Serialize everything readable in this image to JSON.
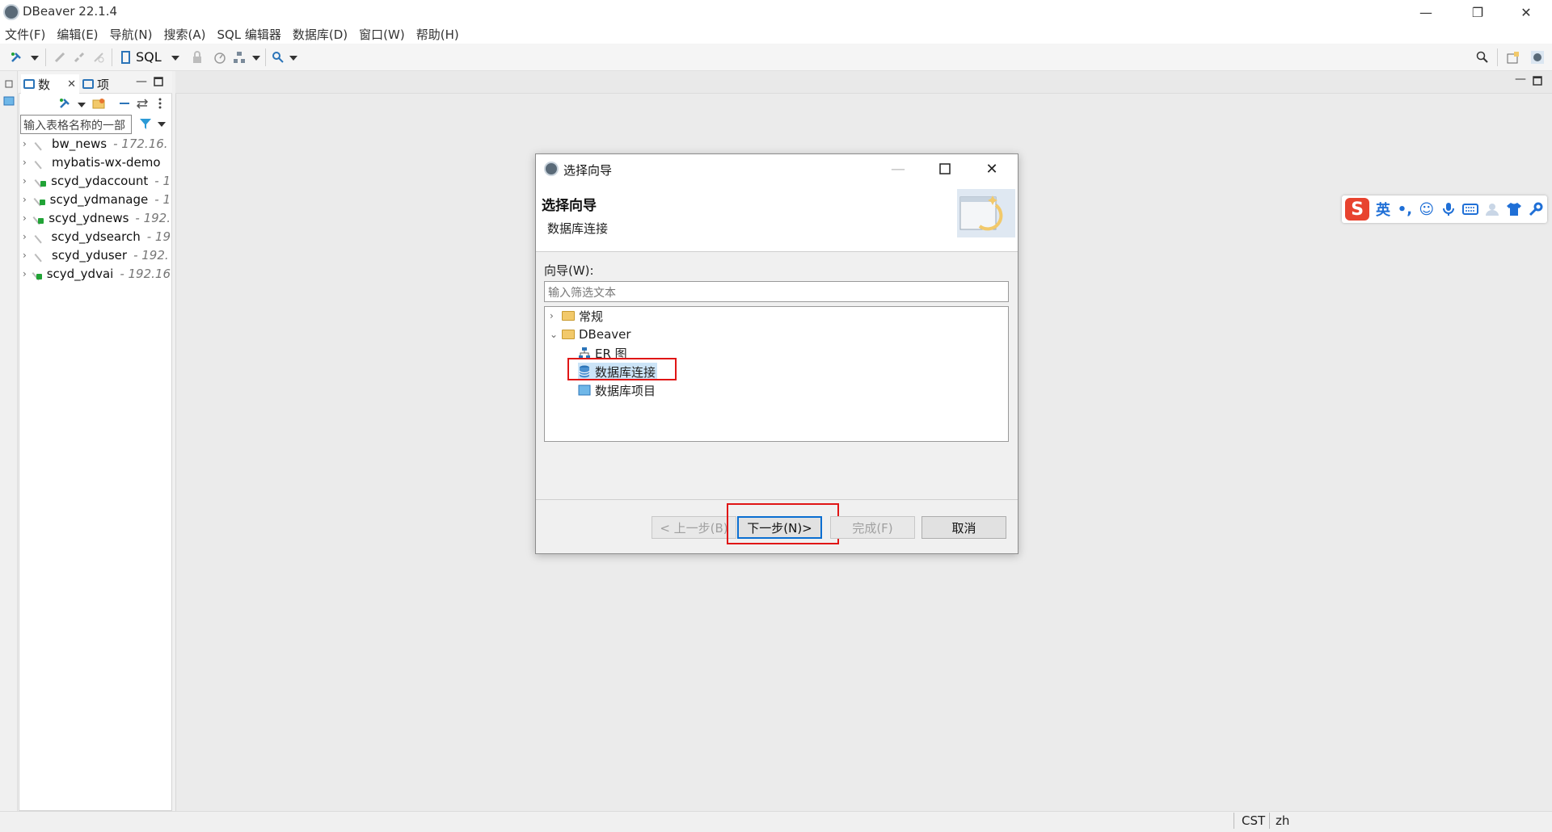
{
  "window": {
    "title": "DBeaver 22.1.4",
    "controls": [
      "—",
      "❐",
      "✕"
    ]
  },
  "menu": [
    {
      "label": "文件(F)"
    },
    {
      "label": "编辑(E)"
    },
    {
      "label": "导航(N)"
    },
    {
      "label": "搜索(A)"
    },
    {
      "label": "SQL 编辑器"
    },
    {
      "label": "数据库(D)"
    },
    {
      "label": "窗口(W)"
    },
    {
      "label": "帮助(H)"
    }
  ],
  "toolbar": {
    "sql_label": "SQL"
  },
  "navigator": {
    "tab_databases": "数",
    "tab_projects": "项",
    "filter_placeholder": "输入表格名称的一部",
    "connections": [
      {
        "name": "bw_news",
        "host": "- 172.16.",
        "connected": false
      },
      {
        "name": "mybatis-wx-demo",
        "host": "",
        "connected": false
      },
      {
        "name": "scyd_ydaccount",
        "host": "- 1",
        "connected": true
      },
      {
        "name": "scyd_ydmanage",
        "host": "- 1",
        "connected": true
      },
      {
        "name": "scyd_ydnews",
        "host": "- 192.",
        "connected": true
      },
      {
        "name": "scyd_ydsearch",
        "host": "- 19",
        "connected": false
      },
      {
        "name": "scyd_yduser",
        "host": "- 192.",
        "connected": false
      },
      {
        "name": "scyd_ydvai",
        "host": "- 192.16",
        "connected": true
      }
    ]
  },
  "dialog": {
    "title": "选择向导",
    "heading": "选择向导",
    "subheading": "数据库连接",
    "wizard_label": "向导(W):",
    "filter_placeholder": "输入筛选文本",
    "tree": {
      "general": "常规",
      "dbeaver": "DBeaver",
      "er": "ER 图",
      "db_connection": "数据库连接",
      "db_project": "数据库项目"
    },
    "buttons": {
      "back": "< 上一步(B)",
      "next": "下一步(N)>",
      "finish": "完成(F)",
      "cancel": "取消"
    }
  },
  "ime": {
    "logo": "S",
    "mode": "英"
  },
  "status": {
    "timezone": "CST",
    "locale": "zh"
  },
  "colors": {
    "accent": "#2b74b8",
    "highlight_box": "#e01515",
    "connected": "#21a336"
  }
}
